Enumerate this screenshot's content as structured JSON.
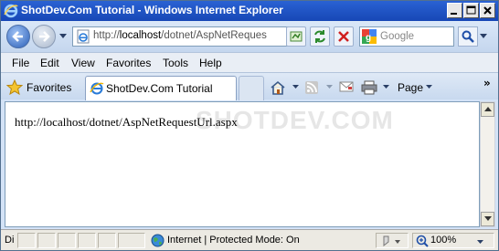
{
  "window": {
    "title": "ShotDev.Com Tutorial - Windows Internet Explorer"
  },
  "address": {
    "url_prefix": "http://",
    "url_host": "localhost",
    "url_path": "/dotnet/AspNetReques"
  },
  "search": {
    "placeholder": "Google"
  },
  "menu": {
    "items": [
      "File",
      "Edit",
      "View",
      "Favorites",
      "Tools",
      "Help"
    ]
  },
  "toolbar": {
    "favorites_label": "Favorites",
    "tab_label": "ShotDev.Com Tutorial",
    "page_label": "Page",
    "overflow": "»"
  },
  "content": {
    "url_text": "http://localhost/dotnet/AspNetRequestUrl.aspx",
    "watermark": "SHOTDEV.COM"
  },
  "status": {
    "done_label": "Di",
    "zone": "Internet | Protected Mode: On",
    "zoom": "100%"
  },
  "icons": {
    "back": "back-arrow-icon",
    "forward": "forward-arrow-icon",
    "page": "ie-page-icon",
    "compat": "compatibility-icon",
    "refresh": "refresh-icon",
    "stop": "stop-icon",
    "search": "search-icon",
    "home": "home-icon",
    "feeds": "rss-icon",
    "mail": "mail-icon",
    "print": "print-icon",
    "globe": "globe-icon"
  },
  "colors": {
    "titlebar": "#1f4fbf",
    "accent": "#2b5fb8"
  }
}
